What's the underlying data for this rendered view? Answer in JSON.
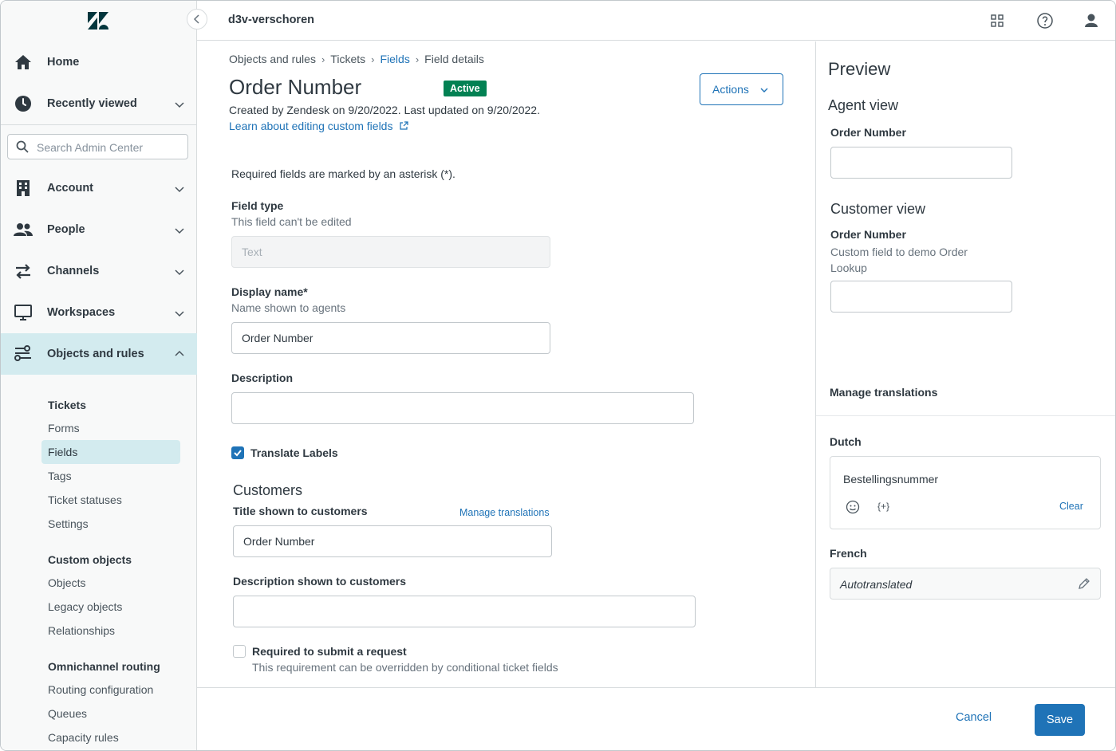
{
  "topbar": {
    "brand": "d3v-verschoren",
    "icons": [
      "apps-grid-icon",
      "help-icon",
      "user-icon"
    ]
  },
  "sidebar": {
    "home": "Home",
    "recently_viewed": "Recently viewed",
    "search_placeholder": "Search Admin Center",
    "account": "Account",
    "people": "People",
    "channels": "Channels",
    "workspaces": "Workspaces",
    "objects_rules": "Objects and rules",
    "groups": [
      {
        "title": "Tickets",
        "items": [
          "Forms",
          "Fields",
          "Tags",
          "Ticket statuses",
          "Settings"
        ]
      },
      {
        "title": "Custom objects",
        "items": [
          "Objects",
          "Legacy objects",
          "Relationships"
        ]
      },
      {
        "title": "Omnichannel routing",
        "items": [
          "Routing configuration",
          "Queues",
          "Capacity rules"
        ]
      }
    ],
    "selected_item": "Fields"
  },
  "breadcrumb": [
    "Objects and rules",
    "Tickets",
    "Fields",
    "Field details"
  ],
  "page": {
    "title": "Order Number",
    "status": "Active",
    "actions_label": "Actions",
    "meta": "Created by Zendesk on 9/20/2022. Last updated on 9/20/2022.",
    "learn_link": "Learn about editing custom fields"
  },
  "form": {
    "required_note": "Required fields are marked by an asterisk (*).",
    "field_type_label": "Field type",
    "field_type_hint": "This field can't be edited",
    "field_type_value": "Text",
    "display_name_label": "Display name*",
    "display_name_hint": "Name shown to agents",
    "display_name_value": "Order Number",
    "description_label": "Description",
    "description_value": "",
    "translate_labels": "Translate Labels",
    "translate_checked": true,
    "customers_title": "Customers",
    "title_customers_label": "Title shown to customers",
    "manage_translations": "Manage translations",
    "title_customers_value": "Order Number",
    "desc_customers_label": "Description shown to customers",
    "desc_customers_value": "",
    "required_label": "Required to submit a request",
    "required_hint": "This requirement can be overridden by conditional ticket fields",
    "required_checked": false
  },
  "preview": {
    "title": "Preview",
    "agent_view": "Agent view",
    "agent_field_label": "Order Number",
    "customer_view": "Customer view",
    "customer_field_label": "Order Number",
    "customer_field_desc": "Custom field to demo Order Lookup",
    "manage_translations": "Manage translations",
    "dutch_label": "Dutch",
    "dutch_value": "Bestellingsnummer",
    "placeholder_icon": "{+}",
    "clear": "Clear",
    "french_label": "French",
    "french_value": "Autotranslated"
  },
  "footer": {
    "cancel": "Cancel",
    "save": "Save"
  },
  "colors": {
    "accent": "#1f73b7",
    "active_badge": "#038153",
    "selected_bg": "#d3ebef"
  }
}
